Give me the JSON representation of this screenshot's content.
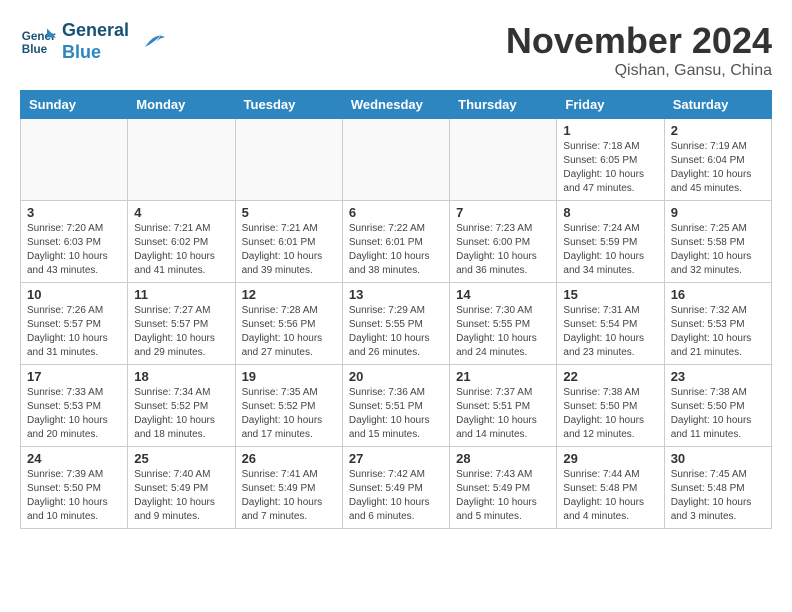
{
  "header": {
    "logo_line1": "General",
    "logo_line2": "Blue",
    "month_title": "November 2024",
    "location": "Qishan, Gansu, China"
  },
  "days_of_week": [
    "Sunday",
    "Monday",
    "Tuesday",
    "Wednesday",
    "Thursday",
    "Friday",
    "Saturday"
  ],
  "weeks": [
    [
      {
        "num": "",
        "info": ""
      },
      {
        "num": "",
        "info": ""
      },
      {
        "num": "",
        "info": ""
      },
      {
        "num": "",
        "info": ""
      },
      {
        "num": "",
        "info": ""
      },
      {
        "num": "1",
        "info": "Sunrise: 7:18 AM\nSunset: 6:05 PM\nDaylight: 10 hours\nand 47 minutes."
      },
      {
        "num": "2",
        "info": "Sunrise: 7:19 AM\nSunset: 6:04 PM\nDaylight: 10 hours\nand 45 minutes."
      }
    ],
    [
      {
        "num": "3",
        "info": "Sunrise: 7:20 AM\nSunset: 6:03 PM\nDaylight: 10 hours\nand 43 minutes."
      },
      {
        "num": "4",
        "info": "Sunrise: 7:21 AM\nSunset: 6:02 PM\nDaylight: 10 hours\nand 41 minutes."
      },
      {
        "num": "5",
        "info": "Sunrise: 7:21 AM\nSunset: 6:01 PM\nDaylight: 10 hours\nand 39 minutes."
      },
      {
        "num": "6",
        "info": "Sunrise: 7:22 AM\nSunset: 6:01 PM\nDaylight: 10 hours\nand 38 minutes."
      },
      {
        "num": "7",
        "info": "Sunrise: 7:23 AM\nSunset: 6:00 PM\nDaylight: 10 hours\nand 36 minutes."
      },
      {
        "num": "8",
        "info": "Sunrise: 7:24 AM\nSunset: 5:59 PM\nDaylight: 10 hours\nand 34 minutes."
      },
      {
        "num": "9",
        "info": "Sunrise: 7:25 AM\nSunset: 5:58 PM\nDaylight: 10 hours\nand 32 minutes."
      }
    ],
    [
      {
        "num": "10",
        "info": "Sunrise: 7:26 AM\nSunset: 5:57 PM\nDaylight: 10 hours\nand 31 minutes."
      },
      {
        "num": "11",
        "info": "Sunrise: 7:27 AM\nSunset: 5:57 PM\nDaylight: 10 hours\nand 29 minutes."
      },
      {
        "num": "12",
        "info": "Sunrise: 7:28 AM\nSunset: 5:56 PM\nDaylight: 10 hours\nand 27 minutes."
      },
      {
        "num": "13",
        "info": "Sunrise: 7:29 AM\nSunset: 5:55 PM\nDaylight: 10 hours\nand 26 minutes."
      },
      {
        "num": "14",
        "info": "Sunrise: 7:30 AM\nSunset: 5:55 PM\nDaylight: 10 hours\nand 24 minutes."
      },
      {
        "num": "15",
        "info": "Sunrise: 7:31 AM\nSunset: 5:54 PM\nDaylight: 10 hours\nand 23 minutes."
      },
      {
        "num": "16",
        "info": "Sunrise: 7:32 AM\nSunset: 5:53 PM\nDaylight: 10 hours\nand 21 minutes."
      }
    ],
    [
      {
        "num": "17",
        "info": "Sunrise: 7:33 AM\nSunset: 5:53 PM\nDaylight: 10 hours\nand 20 minutes."
      },
      {
        "num": "18",
        "info": "Sunrise: 7:34 AM\nSunset: 5:52 PM\nDaylight: 10 hours\nand 18 minutes."
      },
      {
        "num": "19",
        "info": "Sunrise: 7:35 AM\nSunset: 5:52 PM\nDaylight: 10 hours\nand 17 minutes."
      },
      {
        "num": "20",
        "info": "Sunrise: 7:36 AM\nSunset: 5:51 PM\nDaylight: 10 hours\nand 15 minutes."
      },
      {
        "num": "21",
        "info": "Sunrise: 7:37 AM\nSunset: 5:51 PM\nDaylight: 10 hours\nand 14 minutes."
      },
      {
        "num": "22",
        "info": "Sunrise: 7:38 AM\nSunset: 5:50 PM\nDaylight: 10 hours\nand 12 minutes."
      },
      {
        "num": "23",
        "info": "Sunrise: 7:38 AM\nSunset: 5:50 PM\nDaylight: 10 hours\nand 11 minutes."
      }
    ],
    [
      {
        "num": "24",
        "info": "Sunrise: 7:39 AM\nSunset: 5:50 PM\nDaylight: 10 hours\nand 10 minutes."
      },
      {
        "num": "25",
        "info": "Sunrise: 7:40 AM\nSunset: 5:49 PM\nDaylight: 10 hours\nand 9 minutes."
      },
      {
        "num": "26",
        "info": "Sunrise: 7:41 AM\nSunset: 5:49 PM\nDaylight: 10 hours\nand 7 minutes."
      },
      {
        "num": "27",
        "info": "Sunrise: 7:42 AM\nSunset: 5:49 PM\nDaylight: 10 hours\nand 6 minutes."
      },
      {
        "num": "28",
        "info": "Sunrise: 7:43 AM\nSunset: 5:49 PM\nDaylight: 10 hours\nand 5 minutes."
      },
      {
        "num": "29",
        "info": "Sunrise: 7:44 AM\nSunset: 5:48 PM\nDaylight: 10 hours\nand 4 minutes."
      },
      {
        "num": "30",
        "info": "Sunrise: 7:45 AM\nSunset: 5:48 PM\nDaylight: 10 hours\nand 3 minutes."
      }
    ]
  ]
}
